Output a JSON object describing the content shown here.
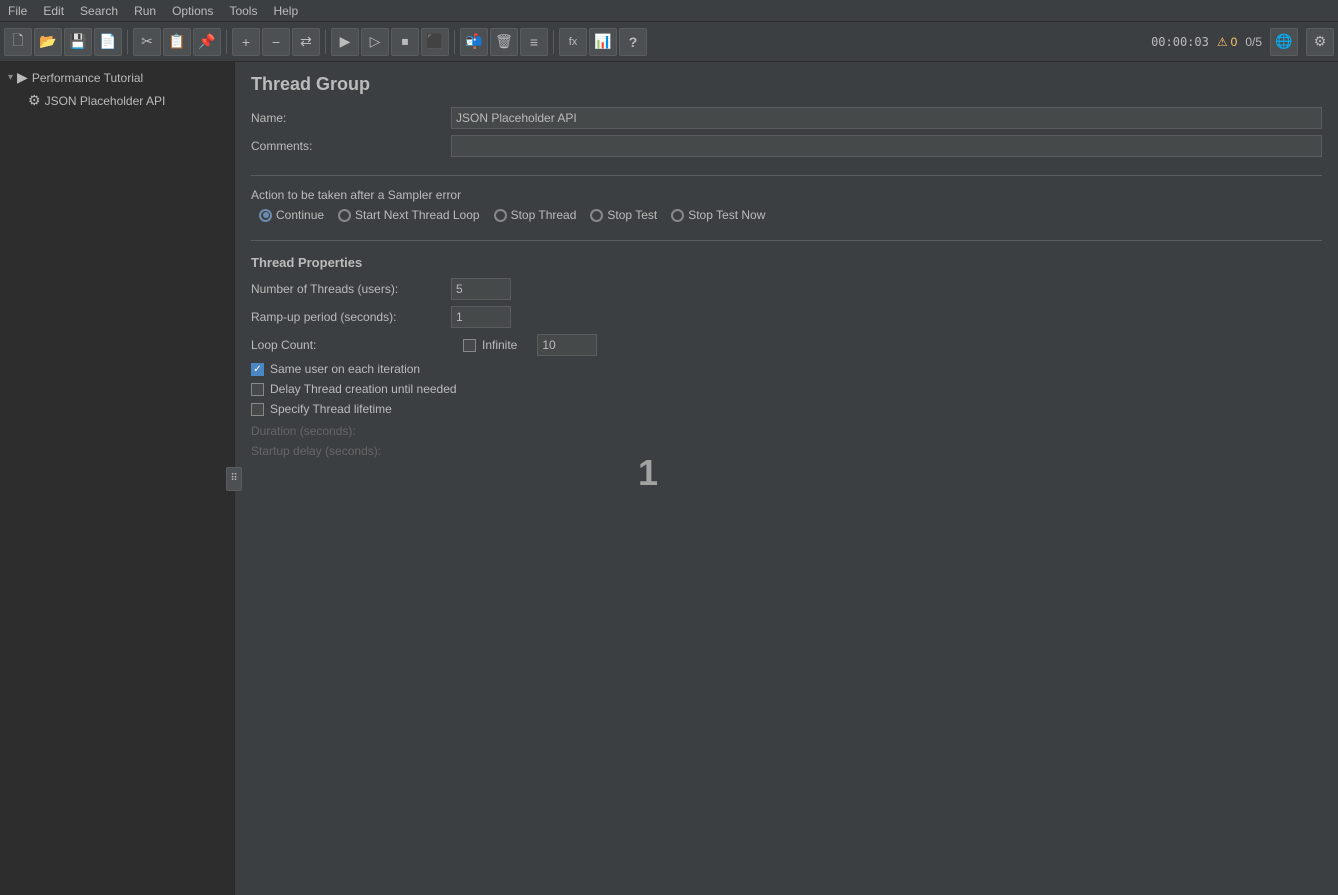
{
  "menubar": {
    "items": [
      "File",
      "Edit",
      "Search",
      "Run",
      "Options",
      "Tools",
      "Help"
    ]
  },
  "toolbar": {
    "buttons": [
      {
        "name": "new-btn",
        "icon": "🗋"
      },
      {
        "name": "open-btn",
        "icon": "📁"
      },
      {
        "name": "save-btn",
        "icon": "💾"
      },
      {
        "name": "save-as-btn",
        "icon": "📄"
      },
      {
        "name": "cut-btn",
        "icon": "✂"
      },
      {
        "name": "copy-btn",
        "icon": "📋"
      },
      {
        "name": "paste-btn",
        "icon": "📌"
      },
      {
        "name": "expand-btn",
        "icon": "+"
      },
      {
        "name": "collapse-btn",
        "icon": "−"
      },
      {
        "name": "toggle-btn",
        "icon": "⇄"
      },
      {
        "name": "run-btn",
        "icon": "▶"
      },
      {
        "name": "run-no-pause-btn",
        "icon": "▷"
      },
      {
        "name": "stop-btn",
        "icon": "⬛"
      },
      {
        "name": "shutdown-btn",
        "icon": "⏹"
      },
      {
        "name": "send-btn",
        "icon": "📬"
      },
      {
        "name": "clear-btn",
        "icon": "🗑"
      },
      {
        "name": "report-btn",
        "icon": "≡"
      },
      {
        "name": "function-btn",
        "icon": "fx"
      },
      {
        "name": "report2-btn",
        "icon": "📊"
      },
      {
        "name": "help-btn",
        "icon": "?"
      }
    ],
    "timer": "00:00:03",
    "warnings": "0",
    "ratio": "0/5"
  },
  "sidebar": {
    "items": [
      {
        "label": "Performance Tutorial",
        "icon": "▶",
        "type": "root",
        "expanded": true
      },
      {
        "label": "JSON Placeholder API",
        "icon": "⚙",
        "type": "child"
      }
    ]
  },
  "panel": {
    "title": "Thread Group",
    "name_label": "Name:",
    "name_value": "JSON Placeholder API",
    "comments_label": "Comments:",
    "comments_value": "",
    "action_label": "Action to be taken after a Sampler error",
    "radio_options": [
      {
        "label": "Continue",
        "checked": true
      },
      {
        "label": "Start Next Thread Loop",
        "checked": false
      },
      {
        "label": "Stop Thread",
        "checked": false
      },
      {
        "label": "Stop Test",
        "checked": false
      },
      {
        "label": "Stop Test Now",
        "checked": false
      }
    ],
    "thread_properties": "Thread Properties",
    "num_threads_label": "Number of Threads (users):",
    "num_threads_value": "5",
    "rampup_label": "Ramp-up period (seconds):",
    "rampup_value": "1",
    "loop_count_label": "Loop Count:",
    "loop_infinite_label": "Infinite",
    "loop_count_value": "10",
    "same_user_label": "Same user on each iteration",
    "same_user_checked": true,
    "delay_thread_label": "Delay Thread creation until needed",
    "delay_thread_checked": false,
    "specify_lifetime_label": "Specify Thread lifetime",
    "specify_lifetime_checked": false,
    "duration_label": "Duration (seconds):",
    "startup_delay_label": "Startup delay (seconds):"
  },
  "cursor": {
    "symbol": "↖",
    "number": "1"
  }
}
